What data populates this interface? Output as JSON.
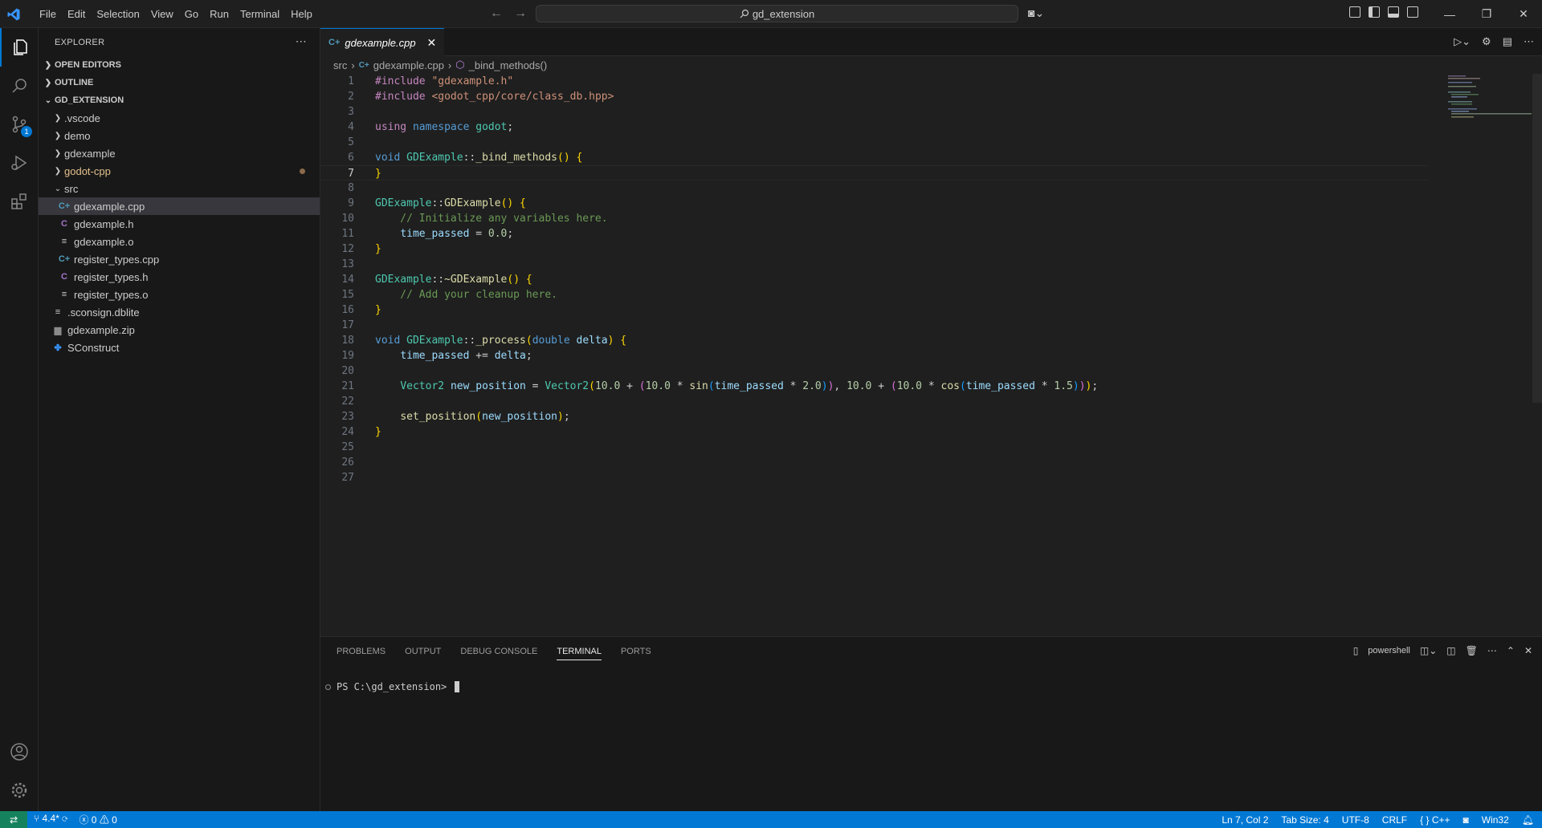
{
  "window": {
    "menu": [
      "File",
      "Edit",
      "Selection",
      "View",
      "Go",
      "Run",
      "Terminal",
      "Help"
    ],
    "search_text": "gd_extension"
  },
  "sidebar": {
    "title": "EXPLORER",
    "sections": {
      "open_editors": "OPEN EDITORS",
      "outline": "OUTLINE",
      "project": "GD_EXTENSION"
    },
    "tree": [
      {
        "label": ".vscode",
        "type": "folder",
        "depth": 0,
        "expanded": false
      },
      {
        "label": "demo",
        "type": "folder",
        "depth": 0,
        "expanded": false
      },
      {
        "label": "gdexample",
        "type": "folder",
        "depth": 0,
        "expanded": false
      },
      {
        "label": "godot-cpp",
        "type": "folder",
        "depth": 0,
        "expanded": false,
        "modified": true
      },
      {
        "label": "src",
        "type": "folder",
        "depth": 0,
        "expanded": true
      },
      {
        "label": "gdexample.cpp",
        "type": "cpp",
        "depth": 1,
        "selected": true
      },
      {
        "label": "gdexample.h",
        "type": "h",
        "depth": 1
      },
      {
        "label": "gdexample.o",
        "type": "file",
        "depth": 1
      },
      {
        "label": "register_types.cpp",
        "type": "cpp",
        "depth": 1
      },
      {
        "label": "register_types.h",
        "type": "h",
        "depth": 1
      },
      {
        "label": "register_types.o",
        "type": "file",
        "depth": 1
      },
      {
        "label": ".sconsign.dblite",
        "type": "file",
        "depth": 0
      },
      {
        "label": "gdexample.zip",
        "type": "zip",
        "depth": 0
      },
      {
        "label": "SConstruct",
        "type": "scons",
        "depth": 0
      }
    ]
  },
  "editor": {
    "tab_label": "gdexample.cpp",
    "breadcrumb": [
      "src",
      "gdexample.cpp",
      "_bind_methods()"
    ],
    "current_line": 7,
    "lines": [
      [
        [
          "#include ",
          "#c586c0"
        ],
        [
          "\"gdexample.h\"",
          "#ce9178"
        ]
      ],
      [
        [
          "#include ",
          "#c586c0"
        ],
        [
          "<godot_cpp/core/class_db.hpp>",
          "#ce9178"
        ]
      ],
      [],
      [
        [
          "using ",
          "#c586c0"
        ],
        [
          "namespace ",
          "#569cd6"
        ],
        [
          "godot",
          "#4ec9b0"
        ],
        [
          ";",
          "#cccccc"
        ]
      ],
      [],
      [
        [
          "void ",
          "#569cd6"
        ],
        [
          "GDExample",
          "#4ec9b0"
        ],
        [
          "::",
          "#cccccc"
        ],
        [
          "_bind_methods",
          "#dcdcaa"
        ],
        [
          "() ",
          "#ffd700"
        ],
        [
          "{",
          "#ffd700"
        ]
      ],
      [
        [
          "}",
          "#ffd700"
        ]
      ],
      [],
      [
        [
          "GDExample",
          "#4ec9b0"
        ],
        [
          "::",
          "#cccccc"
        ],
        [
          "GDExample",
          "#dcdcaa"
        ],
        [
          "() ",
          "#ffd700"
        ],
        [
          "{",
          "#ffd700"
        ]
      ],
      [
        [
          "    // Initialize any variables here.",
          "#6a9955"
        ]
      ],
      [
        [
          "    ",
          "#cccccc"
        ],
        [
          "time_passed",
          "#9cdcfe"
        ],
        [
          " = ",
          "#cccccc"
        ],
        [
          "0.0",
          "#b5cea8"
        ],
        [
          ";",
          "#cccccc"
        ]
      ],
      [
        [
          "}",
          "#ffd700"
        ]
      ],
      [],
      [
        [
          "GDExample",
          "#4ec9b0"
        ],
        [
          "::",
          "#cccccc"
        ],
        [
          "~GDExample",
          "#dcdcaa"
        ],
        [
          "() ",
          "#ffd700"
        ],
        [
          "{",
          "#ffd700"
        ]
      ],
      [
        [
          "    // Add your cleanup here.",
          "#6a9955"
        ]
      ],
      [
        [
          "}",
          "#ffd700"
        ]
      ],
      [],
      [
        [
          "void ",
          "#569cd6"
        ],
        [
          "GDExample",
          "#4ec9b0"
        ],
        [
          "::",
          "#cccccc"
        ],
        [
          "_process",
          "#dcdcaa"
        ],
        [
          "(",
          "#ffd700"
        ],
        [
          "double ",
          "#569cd6"
        ],
        [
          "delta",
          "#9cdcfe"
        ],
        [
          ") ",
          "#ffd700"
        ],
        [
          "{",
          "#ffd700"
        ]
      ],
      [
        [
          "    ",
          "#cccccc"
        ],
        [
          "time_passed",
          "#9cdcfe"
        ],
        [
          " += ",
          "#cccccc"
        ],
        [
          "delta",
          "#9cdcfe"
        ],
        [
          ";",
          "#cccccc"
        ]
      ],
      [],
      [
        [
          "    ",
          "#cccccc"
        ],
        [
          "Vector2 ",
          "#4ec9b0"
        ],
        [
          "new_position",
          "#9cdcfe"
        ],
        [
          " = ",
          "#cccccc"
        ],
        [
          "Vector2",
          "#4ec9b0"
        ],
        [
          "(",
          "#ffd700"
        ],
        [
          "10.0",
          "#b5cea8"
        ],
        [
          " + ",
          "#cccccc"
        ],
        [
          "(",
          "#da70d6"
        ],
        [
          "10.0",
          "#b5cea8"
        ],
        [
          " * ",
          "#cccccc"
        ],
        [
          "sin",
          "#dcdcaa"
        ],
        [
          "(",
          "#179fff"
        ],
        [
          "time_passed",
          "#9cdcfe"
        ],
        [
          " * ",
          "#cccccc"
        ],
        [
          "2.0",
          "#b5cea8"
        ],
        [
          ")",
          "#179fff"
        ],
        [
          ")",
          "#da70d6"
        ],
        [
          ", ",
          "#cccccc"
        ],
        [
          "10.0",
          "#b5cea8"
        ],
        [
          " + ",
          "#cccccc"
        ],
        [
          "(",
          "#da70d6"
        ],
        [
          "10.0",
          "#b5cea8"
        ],
        [
          " * ",
          "#cccccc"
        ],
        [
          "cos",
          "#dcdcaa"
        ],
        [
          "(",
          "#179fff"
        ],
        [
          "time_passed",
          "#9cdcfe"
        ],
        [
          " * ",
          "#cccccc"
        ],
        [
          "1.5",
          "#b5cea8"
        ],
        [
          ")",
          "#179fff"
        ],
        [
          ")",
          "#da70d6"
        ],
        [
          ")",
          "#ffd700"
        ],
        [
          ";",
          "#cccccc"
        ]
      ],
      [],
      [
        [
          "    ",
          "#cccccc"
        ],
        [
          "set_position",
          "#dcdcaa"
        ],
        [
          "(",
          "#ffd700"
        ],
        [
          "new_position",
          "#9cdcfe"
        ],
        [
          ")",
          "#ffd700"
        ],
        [
          ";",
          "#cccccc"
        ]
      ],
      [
        [
          "}",
          "#ffd700"
        ]
      ],
      [],
      [],
      []
    ]
  },
  "panel": {
    "tabs": [
      "PROBLEMS",
      "OUTPUT",
      "DEBUG CONSOLE",
      "TERMINAL",
      "PORTS"
    ],
    "active_tab": "TERMINAL",
    "shell_label": "powershell",
    "prompt": "PS C:\\gd_extension>"
  },
  "statusbar": {
    "branch": "4.4*",
    "errors": "0",
    "warnings": "0",
    "position": "Ln 7, Col 2",
    "tab_size": "Tab Size: 4",
    "encoding": "UTF-8",
    "eol": "CRLF",
    "language": "C++",
    "platform": "Win32"
  },
  "activity": {
    "scm_badge": "1"
  },
  "colors": {
    "accent": "#0078d4",
    "remote": "#16825d",
    "folder_modified": "#e2c08d",
    "cpp_icon": "#519aba",
    "h_icon": "#a074c4"
  }
}
